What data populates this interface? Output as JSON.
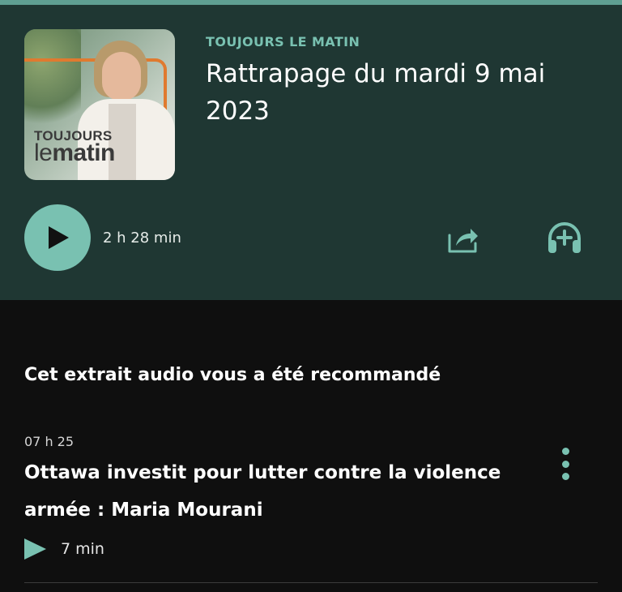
{
  "header": {
    "show_name": "TOUJOURS LE MATIN",
    "episode_title": "Rattrapage du mardi 9 mai 2023",
    "duration": "2 h 28 min",
    "cover": {
      "logo_top": "TOUJOURS",
      "logo_bottom_light": "le",
      "logo_bottom_bold": "matin"
    }
  },
  "actions": {
    "play_icon": "play-icon",
    "share_icon": "share-icon",
    "listen_icon": "headphones-plus-icon"
  },
  "section": {
    "title": "Cet extrait audio vous a été recommandé"
  },
  "clip": {
    "time": "07 h 25",
    "title": "Ottawa investit pour lutter contre la violence armée  :  Maria Mourani",
    "duration": "7 min"
  },
  "colors": {
    "accent": "#79c1b1",
    "header_bg": "#1f3733",
    "body_bg": "#0f0f0f",
    "orange": "#e07a2f"
  }
}
